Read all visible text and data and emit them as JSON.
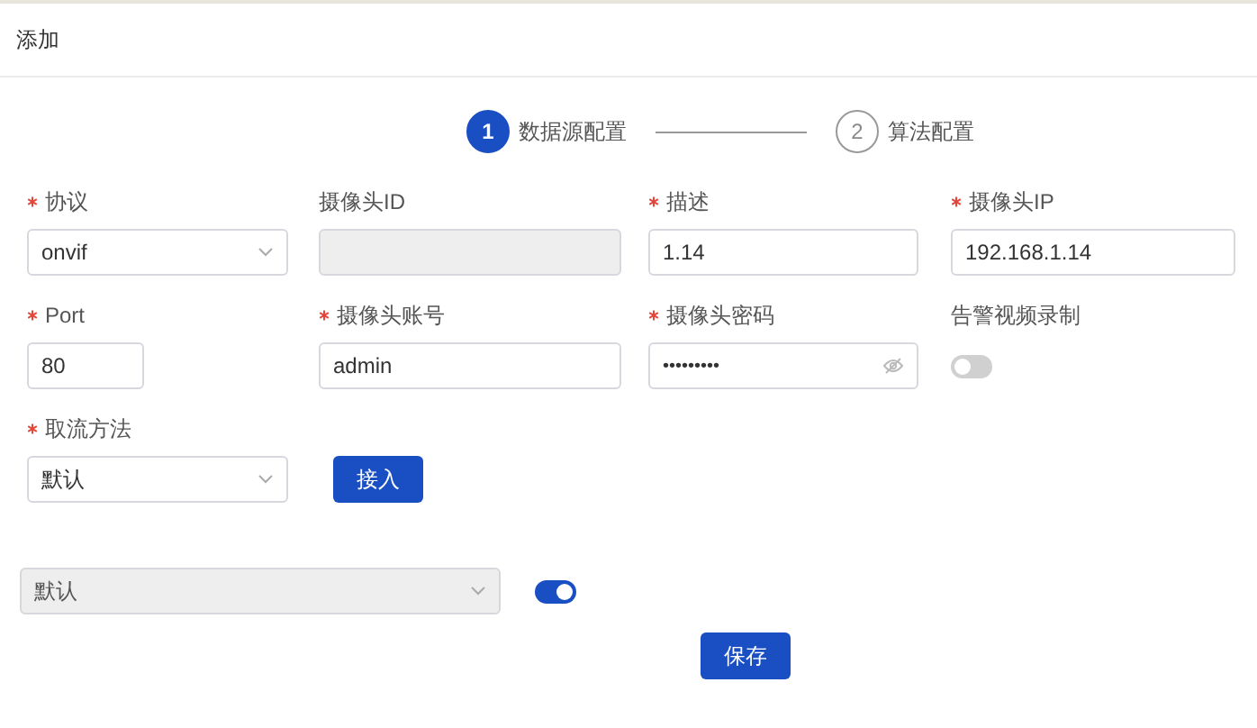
{
  "title": "添加",
  "steps": [
    {
      "number": "1",
      "label": "数据源配置",
      "selected": true
    },
    {
      "number": "2",
      "label": "算法配置",
      "selected": false
    }
  ],
  "rows": [
    [
      {
        "kind": "select",
        "label": "协议",
        "required": true,
        "value": "onvif",
        "disabled": false
      },
      {
        "kind": "input",
        "label": "摄像头ID",
        "required": false,
        "disabled": true
      },
      {
        "kind": "input",
        "label": "描述",
        "required": true,
        "value": "1.14",
        "disabled": false
      },
      {
        "kind": "input",
        "label": "摄像头IP",
        "required": true,
        "value": "192.168.1.14",
        "disabled": false
      }
    ],
    [
      {
        "kind": "input",
        "label": "Port",
        "required": true,
        "value": "80",
        "disabled": false
      },
      {
        "kind": "input",
        "label": "摄像头账号",
        "required": true,
        "value": "admin",
        "disabled": false
      },
      {
        "kind": "password",
        "label": "摄像头密码",
        "required": true,
        "value": "•••••••••",
        "disabled": false
      },
      {
        "kind": "switch",
        "label": "告警视频录制",
        "required": false,
        "on": false
      }
    ],
    [
      {
        "kind": "select",
        "label": "取流方法",
        "required": true,
        "value": "默认",
        "disabled": false
      },
      {
        "kind": "button",
        "label": "接入"
      }
    ]
  ],
  "extra": {
    "select": {
      "value": "默认",
      "disabled": true
    },
    "switch": {
      "on": true
    }
  },
  "save_button": "保存"
}
